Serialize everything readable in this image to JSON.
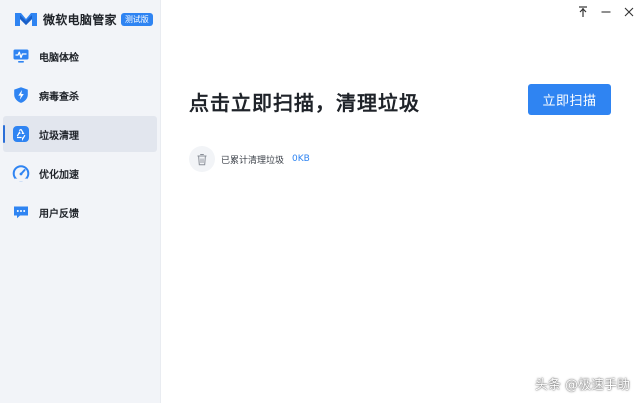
{
  "app": {
    "name": "微软电脑管家",
    "badge": "测试版",
    "brand_color": "#2f84f2"
  },
  "sidebar": {
    "items": [
      {
        "label": "电脑体检",
        "icon": "monitor-pulse-icon",
        "active": false
      },
      {
        "label": "病毒查杀",
        "icon": "shield-lightning-icon",
        "active": false
      },
      {
        "label": "垃圾清理",
        "icon": "recycle-icon",
        "active": true
      },
      {
        "label": "优化加速",
        "icon": "speedometer-icon",
        "active": false
      },
      {
        "label": "用户反馈",
        "icon": "chat-bubble-icon",
        "active": false
      }
    ]
  },
  "window_controls": {
    "pin": "pin-icon",
    "minimize": "minimize-icon",
    "close": "close-icon"
  },
  "main": {
    "headline": "点击立即扫描，清理垃圾",
    "scan_button": "立即扫描",
    "stats_label": "已累计清理垃圾",
    "stats_value": "0KB"
  },
  "watermark": "头条 @极速手助"
}
